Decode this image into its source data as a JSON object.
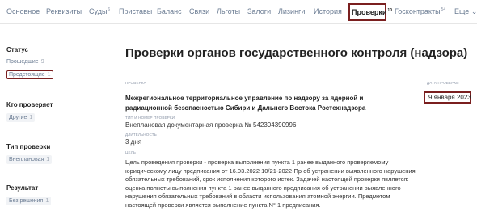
{
  "nav": {
    "items": [
      {
        "label": "Основное",
        "count": ""
      },
      {
        "label": "Реквизиты",
        "count": ""
      },
      {
        "label": "Суды",
        "count": "6"
      },
      {
        "label": "Приставы",
        "count": ""
      },
      {
        "label": "Баланс",
        "count": ""
      },
      {
        "label": "Связи",
        "count": ""
      },
      {
        "label": "Льготы",
        "count": ""
      },
      {
        "label": "Залоги",
        "count": ""
      },
      {
        "label": "Лизинги",
        "count": ""
      },
      {
        "label": "История",
        "count": ""
      }
    ],
    "active": {
      "label": "Проверки",
      "count": "10"
    },
    "after": [
      {
        "label": "Госконтракты",
        "count": "54"
      },
      {
        "label": "Еще",
        "count": ""
      }
    ],
    "more_arrow": "⌄"
  },
  "sidebar": {
    "status": {
      "title": "Статус",
      "items": [
        {
          "label": "Прошедшие",
          "count": "9"
        },
        {
          "label": "Предстоящие",
          "count": "1"
        }
      ]
    },
    "inspector": {
      "title": "Кто проверяет",
      "items": [
        {
          "label": "Другие",
          "count": "1"
        }
      ]
    },
    "type": {
      "title": "Тип проверки",
      "items": [
        {
          "label": "Внеплановая",
          "count": "1"
        }
      ]
    },
    "result": {
      "title": "Результат",
      "items": [
        {
          "label": "Без решения",
          "count": "1"
        }
      ]
    }
  },
  "main": {
    "title": "Проверки органов государственного контроля (надзора)",
    "authority_label": "ПРОВЕРКА",
    "authority": "Межрегиональное территориальное управление по надзору за ядерной и радиационной безопасностью Сибири и Дальнего Востока Ростехнадзора",
    "date_label": "ДАТА ПРОВЕРКИ",
    "date": "9 января 2023",
    "type_label": "ТИП И НОМЕР ПРОВЕРКИ",
    "type_value": "Внеплановая документарная проверка № 542304390996",
    "duration_label": "ДЛИТЕЛЬНОСТЬ",
    "duration_value": "3 дня",
    "purpose_label": "ЦЕЛЬ",
    "purpose": "Цель проведения проверки - проверка выполнения пункта 1 ранее выданного проверяемому юридическому лицу предписания от 16.03.2022 10/21-2022-Пр об устранении выявленного нарушения обязательных требований, срок исполнения которого истек. Задачей настоящей проверки является: оценка полноты выполнения пункта 1 ранее выданного предписания об устранении выявленного нарушения обязательных требований в области использования атомной энергии. Предметом настоящей проверки является выполнение пункта N° 1 предписания."
  }
}
